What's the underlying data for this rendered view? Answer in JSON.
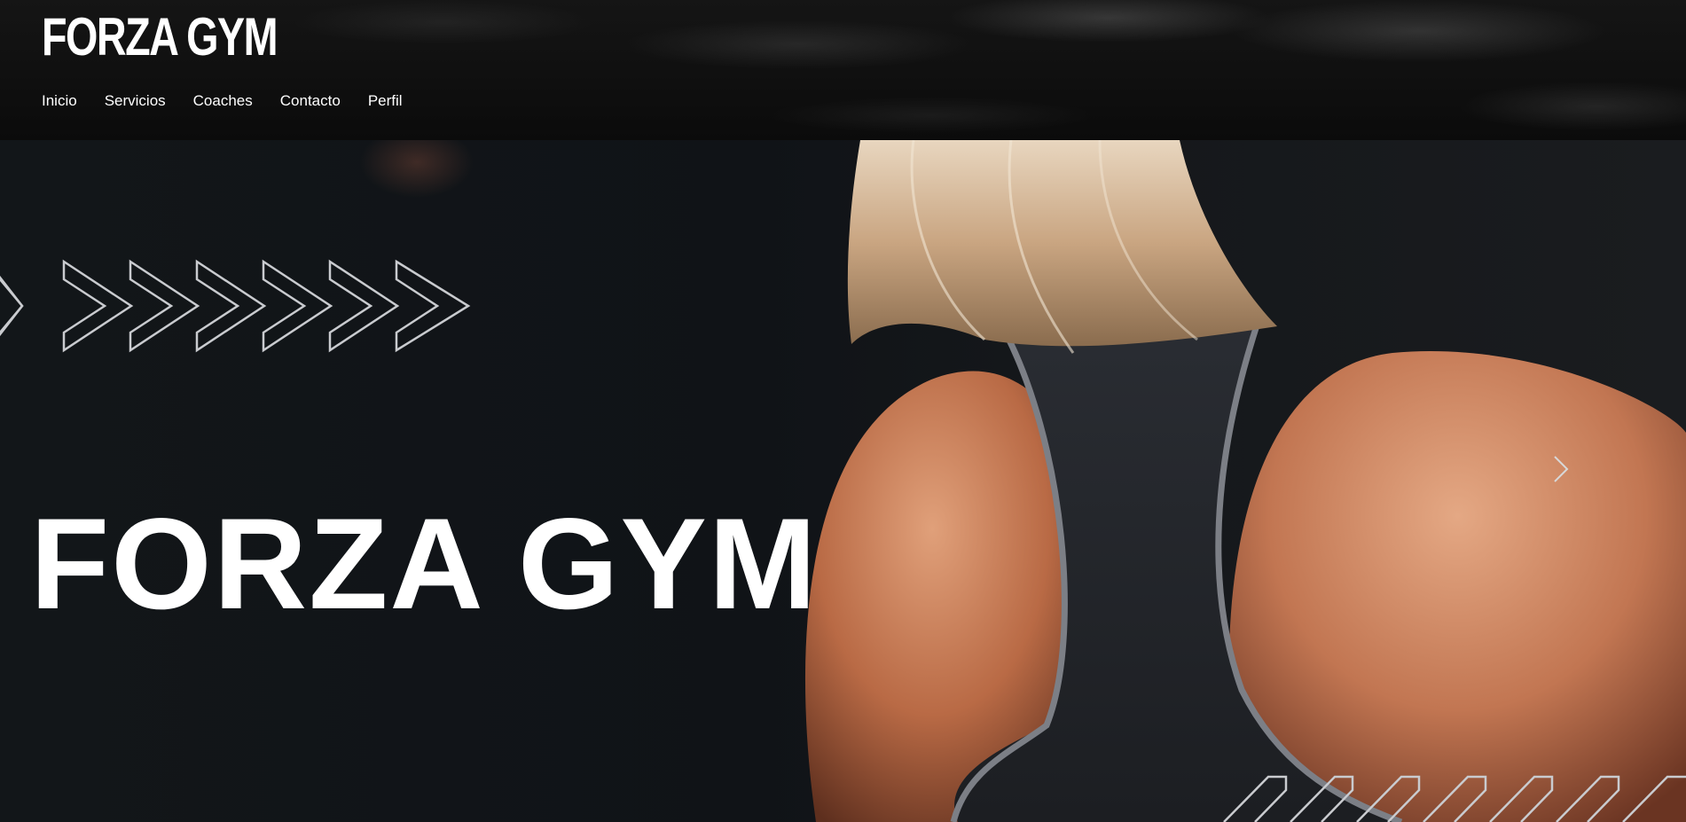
{
  "header": {
    "brand": "FORZA GYM",
    "nav": [
      {
        "label": "Inicio"
      },
      {
        "label": "Servicios"
      },
      {
        "label": "Coaches"
      },
      {
        "label": "Contacto"
      },
      {
        "label": "Perfil"
      }
    ]
  },
  "hero": {
    "title": "FORZA GYM",
    "next_icon": "chevron-right-icon",
    "decor_icon": "chevron-pattern-icon"
  },
  "colors": {
    "text": "#ffffff",
    "background": "#0f1113",
    "header_background": "#0b0b0b"
  }
}
